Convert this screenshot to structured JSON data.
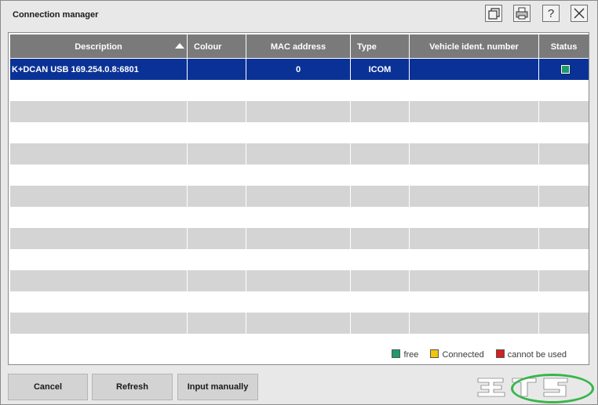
{
  "window": {
    "title": "Connection manager",
    "title_buttons": [
      "restore-icon",
      "print-icon",
      "help-icon",
      "close-icon"
    ],
    "help_glyph": "?"
  },
  "table": {
    "columns": [
      "Description",
      "Colour",
      "MAC address",
      "Type",
      "Vehicle ident. number",
      "Status"
    ],
    "sorted_column": "Description",
    "sort_direction": "ascending",
    "rows": [
      {
        "description": "K+DCAN USB 169.254.0.8:6801",
        "colour": "",
        "mac": "0",
        "type": "ICOM",
        "vin": "",
        "status": "free",
        "selected": true
      }
    ],
    "empty_row_count": 12,
    "colors": {
      "header": "#7a7a7a",
      "selection": "#0a3296",
      "alt_row": "#d4d4d4"
    }
  },
  "legend": [
    {
      "label": "free",
      "color": "#1f9a6a"
    },
    {
      "label": "Connected",
      "color": "#f2c40e"
    },
    {
      "label": "cannot be used",
      "color": "#d42020"
    }
  ],
  "buttons": {
    "cancel": "Cancel",
    "refresh": "Refresh",
    "input_manually": "Input manually"
  }
}
